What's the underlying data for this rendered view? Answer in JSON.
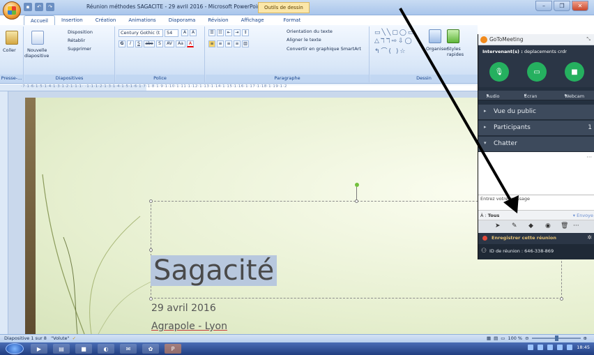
{
  "window": {
    "title": "Réunion méthodes SAGACITE - 29 avril 2016 - Microsoft PowerPoint",
    "context_tab": "Outils de dessin"
  },
  "ribbon": {
    "tabs": [
      "Accueil",
      "Insertion",
      "Création",
      "Animations",
      "Diaporama",
      "Révision",
      "Affichage",
      "Format"
    ],
    "active_tab": "Accueil",
    "clipboard": {
      "paste": "Coller",
      "label": "Presse-..."
    },
    "slides": {
      "new_slide_1": "Nouvelle",
      "new_slide_2": "diapositive",
      "layout": "Disposition",
      "reset": "Rétablir",
      "delete": "Supprimer",
      "label": "Diapositives"
    },
    "font": {
      "name": "Century Gothic (t",
      "size": "54",
      "bold": "G",
      "italic": "I",
      "underline": "S",
      "strike": "abe",
      "shadow": "S",
      "spacing": "AV",
      "case": "Aa",
      "color": "A",
      "label": "Police"
    },
    "paragraph": {
      "text_direction": "Orientation du texte",
      "align_text": "Aligner le texte",
      "smartart": "Convertir en graphique SmartArt",
      "label": "Paragraphe"
    },
    "drawing": {
      "arrange": "Organiser",
      "styles": "Styles",
      "styles_2": "rapides",
      "label": "Dessin"
    }
  },
  "ruler": {
    "ticks": "·7·1·6·1·5·1·4·1·3·1·2·1·1·1· ·1·1·1·2·1·3·1·4·1·5·1·6·1·7·1·8·1·9·1·10·1·11·1·12·1·13·1·14·1·15·1·16·1·17·1·18·1·19·1·2"
  },
  "slide": {
    "title": "Sagacité",
    "date": "29 avril 2016",
    "place": "Agrapole - Lyon"
  },
  "status": {
    "slide_info": "Diapositive 1 sur 8",
    "theme": "\"Volute\"",
    "zoom": "100 %"
  },
  "taskbar": {
    "time": "18:45"
  },
  "gtm": {
    "app_name": "GoToMeeting",
    "presenter_label": "Intervenant(s) :",
    "presenter_name": "deplacements crdr",
    "audio": "Audio",
    "screen": "Écran",
    "webcam": "Webcam",
    "sections": [
      {
        "title": "Vue du public",
        "count": ""
      },
      {
        "title": "Participants",
        "count": "1"
      },
      {
        "title": "Chatter",
        "count": ""
      }
    ],
    "chat_placeholder": "Entrez votre message",
    "to_label": "À :",
    "to_value": "Tous",
    "send": "Envoye",
    "record": "Enregistrer cette réunion",
    "meeting_id": "ID de réunion : 646-338-869"
  },
  "colors": {
    "accent_green": "#25b05f",
    "panel_dark": "#24303f",
    "office_blue": "#15428b"
  }
}
